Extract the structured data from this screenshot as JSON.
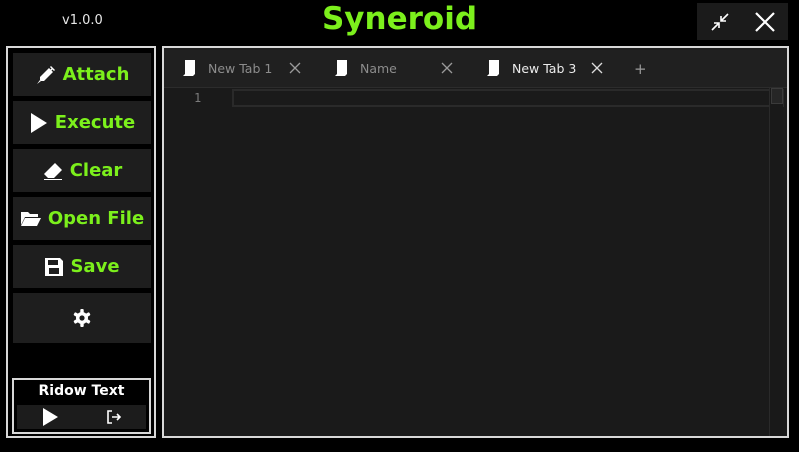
{
  "header": {
    "version": "v1.0.0",
    "title": "Syneroid",
    "accent_color": "#7cf01c"
  },
  "window_controls": {
    "minimize_icon": "collapse-arrows-icon",
    "close_icon": "close-x-icon"
  },
  "sidebar": {
    "attach": "Attach",
    "execute": "Execute",
    "clear": "Clear",
    "open_file": "Open File",
    "save": "Save",
    "settings_icon": "gear-icon"
  },
  "script_panel": {
    "title": "Ridow Text",
    "run_icon": "play-icon",
    "exit_icon": "exit-icon"
  },
  "tabs": [
    {
      "label": "New Tab 1",
      "active": false
    },
    {
      "label": "Name",
      "active": false
    },
    {
      "label": "New Tab 3",
      "active": true
    }
  ],
  "tab_add": "+",
  "editor": {
    "line_numbers": [
      "1"
    ],
    "content": ""
  }
}
